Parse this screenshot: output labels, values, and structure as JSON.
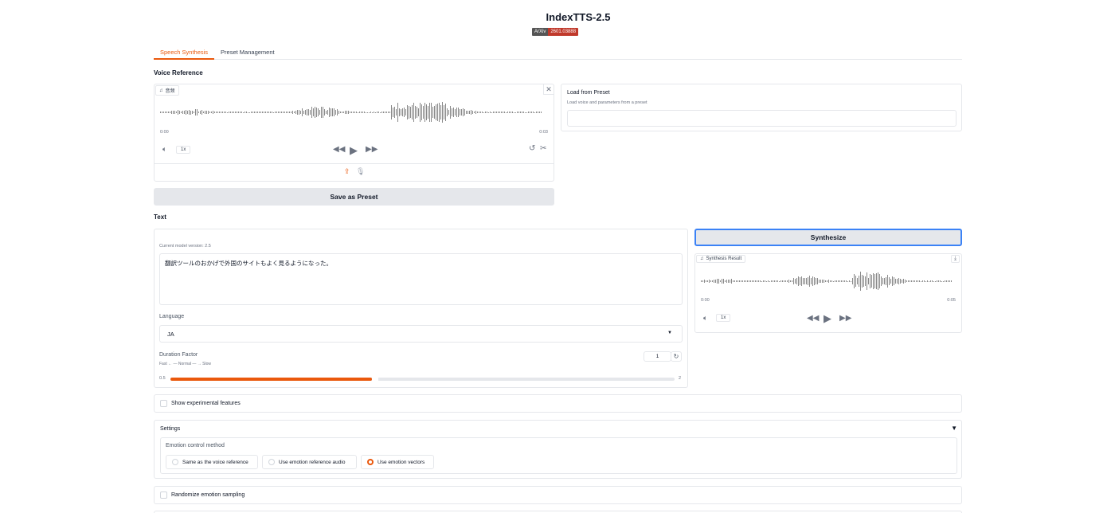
{
  "app": {
    "title": "IndexTTS-2.5",
    "badge_left": "ArXiv",
    "badge_right": "2601.03888"
  },
  "tabs": [
    {
      "label": "Speech Synthesis",
      "active": true
    },
    {
      "label": "Preset Management",
      "active": false
    }
  ],
  "voice_reference": {
    "heading": "Voice Reference",
    "audio_label": "音频",
    "time_start": "0:00",
    "time_end": "0:03",
    "speed": "1x"
  },
  "preset_loader": {
    "title": "Load from Preset",
    "description": "Load voice and parameters from a preset",
    "value": ""
  },
  "save_preset_button": "Save as Preset",
  "text_section": {
    "heading": "Text",
    "model_version": "Current model version: 2.5",
    "text_value": "翻訳ツールのおかげで外国のサイトもよく見るようになった。",
    "language_label": "Language",
    "language_value": "JA",
    "duration_label": "Duration Factor",
    "duration_hint": "Fast ← — Normal — → Slow",
    "duration_value": "1",
    "slider_min": "0.5",
    "slider_max": "2",
    "slider_fraction": 0.4
  },
  "synthesize_button": "Synthesize",
  "synthesis_result": {
    "label": "Synthesis Result",
    "time_start": "0:00",
    "time_end": "0:05",
    "speed": "1x"
  },
  "show_experimental": "Show experimental features",
  "settings": {
    "title": "Settings",
    "emotion_method_label": "Emotion control method",
    "options": [
      {
        "label": "Same as the voice reference",
        "selected": false
      },
      {
        "label": "Use emotion reference audio",
        "selected": false
      },
      {
        "label": "Use emotion vectors",
        "selected": true
      }
    ]
  },
  "randomize_emotion": "Randomize emotion sampling",
  "colors": {
    "accent": "#ea580c",
    "focus_border": "#3b82f6",
    "badge_red": "#c0392b"
  }
}
